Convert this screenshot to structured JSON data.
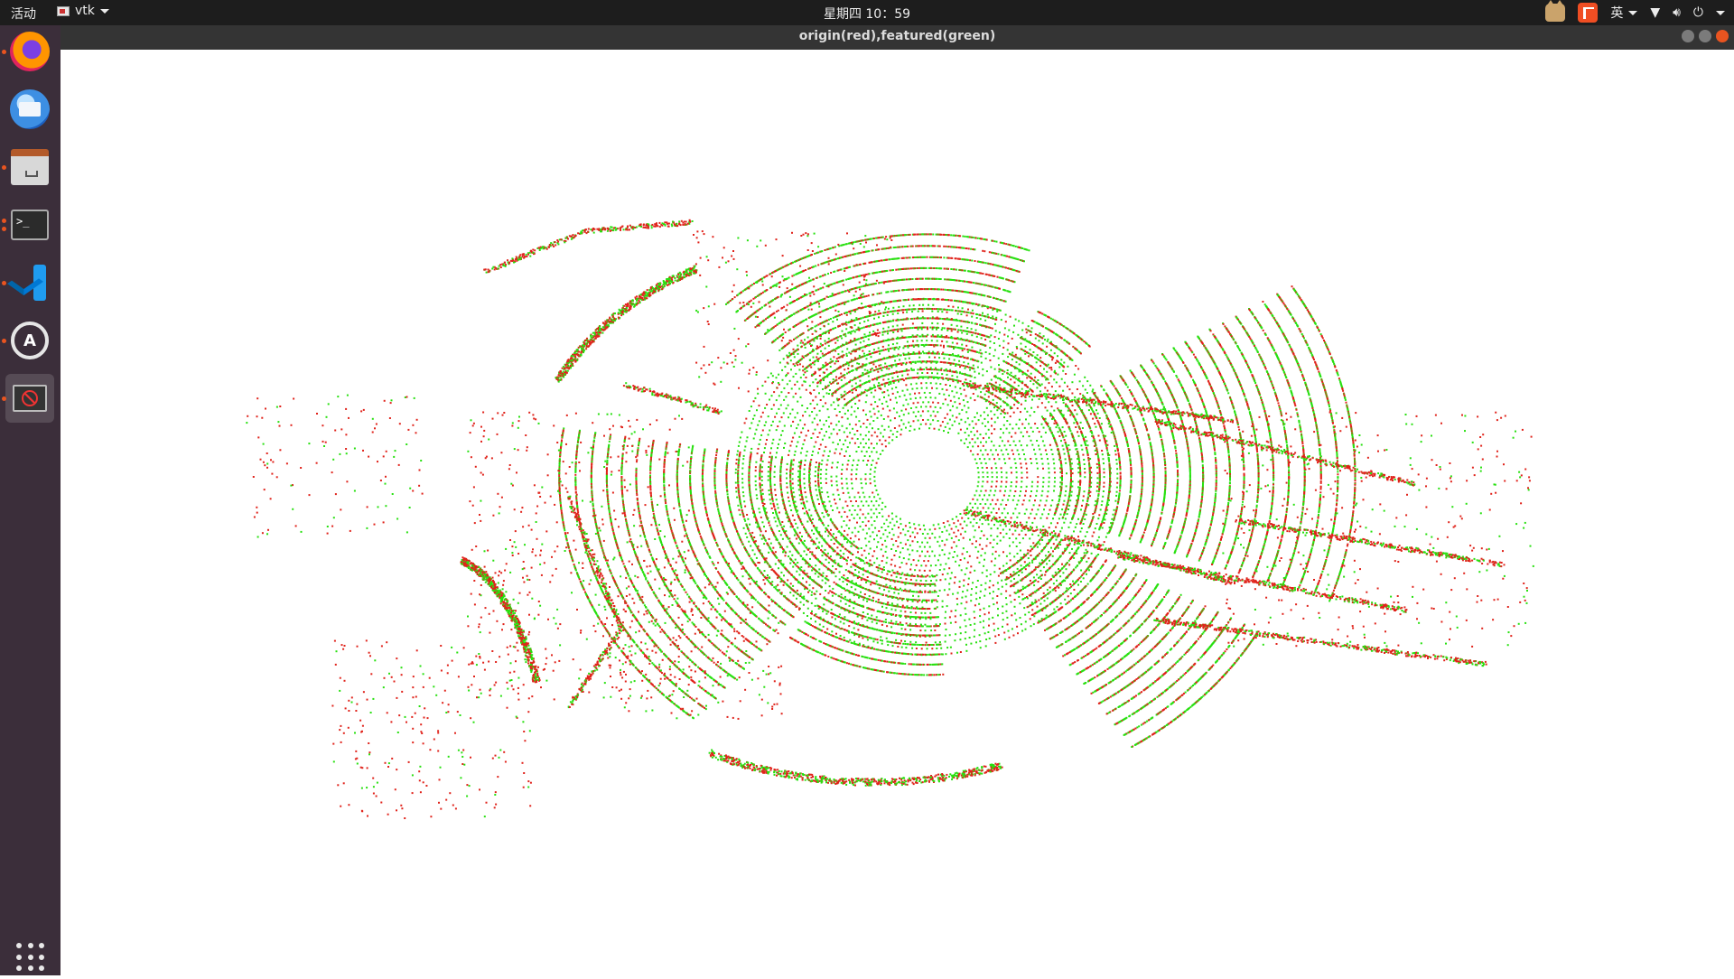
{
  "topbar": {
    "activities": "活动",
    "app_name": "vtk",
    "clock": "星期四 10：59",
    "ime": "英"
  },
  "dock": {
    "items": [
      {
        "name": "firefox",
        "running": true
      },
      {
        "name": "thunderbird",
        "running": false
      },
      {
        "name": "files",
        "running": true
      },
      {
        "name": "terminal",
        "running": true
      },
      {
        "name": "vscode",
        "running": true
      },
      {
        "name": "software-updater",
        "running": true
      },
      {
        "name": "vtk-window",
        "running": true,
        "active": true
      }
    ],
    "terminal_prompt": ">_",
    "updater_letter": "A"
  },
  "window": {
    "title": "origin(red),featured(green)"
  },
  "pointcloud": {
    "colors": {
      "origin": "#e0231b",
      "featured": "#28e010",
      "background": "#ffffff"
    }
  }
}
